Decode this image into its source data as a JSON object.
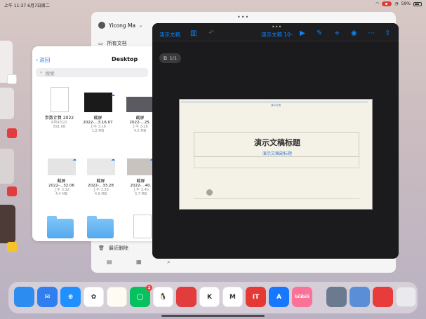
{
  "status_bar": {
    "time": "上午 11:37",
    "date": "6月7日周二",
    "battery": "59%"
  },
  "back_window": {
    "user_name": "Yicong Ma",
    "item_all_docs": "所有文档",
    "item_recently_deleted": "最近删除"
  },
  "files": {
    "back_label": "返回",
    "title": "Desktop",
    "search_placeholder": "搜索",
    "items": [
      {
        "name": "参数计算 2022",
        "meta1": "6月4日22",
        "meta2": "591 KB"
      },
      {
        "name": "截屏",
        "sub": "2022-...3.16.07",
        "meta1": "上午 3.16",
        "meta2": "1.8 MB"
      },
      {
        "name": "截屏",
        "sub": "2022-...25.",
        "meta1": "上午 3.26",
        "meta2": "4.5 MB"
      },
      {
        "name": "截屏",
        "sub": "2022-...32.06",
        "meta1": "上午 3.32",
        "meta2": "4.4 MB"
      },
      {
        "name": "截屏",
        "sub": "2022-...33.28",
        "meta1": "上午 3.33",
        "meta2": "4.9 MB"
      },
      {
        "name": "截屏",
        "sub": "2022-...40.",
        "meta1": "上午 3.40",
        "meta2": "3.7 MB"
      }
    ]
  },
  "keynote": {
    "docs_label": "演示文稿",
    "doc_title": "演示文稿 10",
    "page_indicator": "1/1",
    "slide_top_text": "演示文稿",
    "slide_title": "演示文稿标题",
    "slide_subtitle": "演示文稿副标题"
  },
  "dock": {
    "apps": [
      {
        "name": "files-app-icon",
        "label": "",
        "color": "#2d8cf0"
      },
      {
        "name": "mail-app-icon",
        "label": "✉",
        "color": "#2f7ff0"
      },
      {
        "name": "safari-app-icon",
        "label": "⊕",
        "color": "#1e90ff"
      },
      {
        "name": "photos-app-icon",
        "label": "✿",
        "color": "#ffffff"
      },
      {
        "name": "notes-app-icon",
        "label": "",
        "color": "#fdfbf2"
      },
      {
        "name": "wechat-app-icon",
        "label": "◯",
        "color": "#07c160",
        "badge": "1"
      },
      {
        "name": "qq-app-icon",
        "label": "🐧",
        "color": "#ffffff"
      },
      {
        "name": "unknown-red-app-icon",
        "label": "",
        "color": "#e23c3c"
      },
      {
        "name": "kuaipan-app-icon",
        "label": "K",
        "color": "#ffffff"
      },
      {
        "name": "blue-m-app-icon",
        "label": "M",
        "color": "#ffffff"
      },
      {
        "name": "ithome-app-icon",
        "label": "IT",
        "color": "#e53935"
      },
      {
        "name": "translate-app-icon",
        "label": "A",
        "color": "#1677ff"
      },
      {
        "name": "bilibili-app-icon",
        "label": "bilibili",
        "color": "#fb7299"
      },
      {
        "name": "photo1-app-icon",
        "label": "",
        "color": "#6b7a8f"
      },
      {
        "name": "photo2-app-icon",
        "label": "",
        "color": "#5a8fd8"
      },
      {
        "name": "video-app-icon",
        "label": "",
        "color": "#e83b3b"
      },
      {
        "name": "app-library-icon",
        "label": "",
        "color": "#e9e9ee"
      }
    ]
  }
}
